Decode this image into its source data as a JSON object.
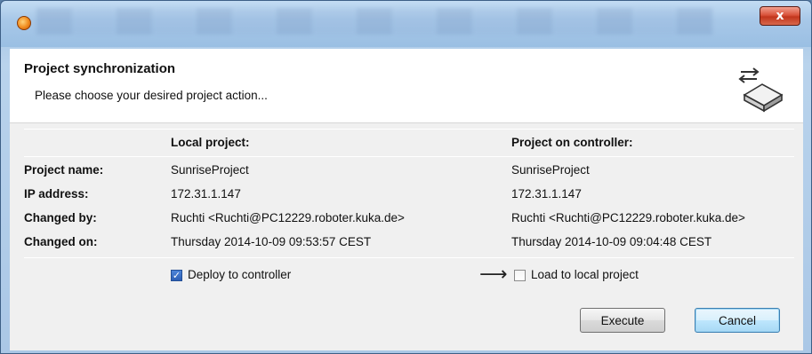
{
  "dialog": {
    "title": "Project synchronization",
    "subtitle": "Please choose your desired project action..."
  },
  "columns": {
    "local": "Local project:",
    "controller": "Project on controller:"
  },
  "rows": [
    {
      "label": "Project name:",
      "local": "SunriseProject",
      "controller": "SunriseProject"
    },
    {
      "label": "IP address:",
      "local": "172.31.1.147",
      "controller": "172.31.1.147"
    },
    {
      "label": "Changed by:",
      "local": "Ruchti <Ruchti@PC12229.roboter.kuka.de>",
      "controller": "Ruchti <Ruchti@PC12229.roboter.kuka.de>"
    },
    {
      "label": "Changed on:",
      "local": "Thursday 2014-10-09 09:53:57 CEST",
      "controller": "Thursday 2014-10-09 09:04:48 CEST"
    }
  ],
  "options": {
    "deploy_label": "Deploy to controller",
    "deploy_checked": true,
    "load_label": "Load to local project",
    "load_checked": false
  },
  "buttons": {
    "execute": "Execute",
    "cancel": "Cancel",
    "close_glyph": "x"
  },
  "icons": {
    "app": "app-icon",
    "sync": "sync-controller-icon",
    "arrow": "arrow-right-icon",
    "check": "✓",
    "arrow_glyph": "⟶"
  },
  "colors": {
    "titlebar": "#a8c8e8",
    "close_button": "#d9533b",
    "focus_button": "#bee6fd"
  }
}
